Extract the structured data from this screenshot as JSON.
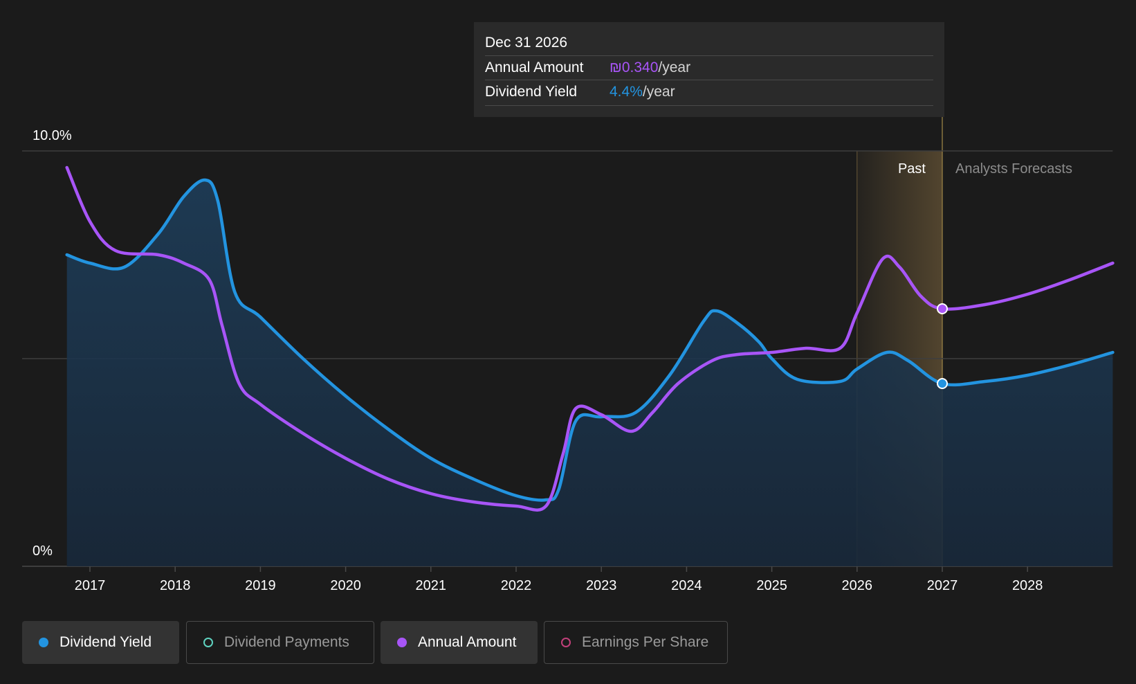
{
  "tooltip": {
    "date": "Dec 31 2026",
    "rows": [
      {
        "label": "Annual Amount",
        "value": "₪0.340",
        "unit": "/year"
      },
      {
        "label": "Dividend Yield",
        "value": "4.4%",
        "unit": "/year"
      }
    ]
  },
  "legend": [
    {
      "label": "Dividend Yield",
      "color": "#2394e0",
      "active": true
    },
    {
      "label": "Dividend Payments",
      "color": "#5fd3c0",
      "active": false
    },
    {
      "label": "Annual Amount",
      "color": "#a855f7",
      "active": true
    },
    {
      "label": "Earnings Per Share",
      "color": "#c2407a",
      "active": false
    }
  ],
  "chart_data": {
    "type": "line",
    "ylim": [
      0,
      10
    ],
    "xlim": [
      2016.5,
      2029.0
    ],
    "y_tick_labels": [
      {
        "value": 10,
        "label": "10.0%"
      },
      {
        "value": 0,
        "label": "0%"
      }
    ],
    "gridlines_y": [
      10,
      5
    ],
    "x_ticks": [
      2017,
      2018,
      2019,
      2020,
      2021,
      2022,
      2023,
      2024,
      2025,
      2026,
      2027,
      2028
    ],
    "x_tick_labels": [
      "2017",
      "2018",
      "2019",
      "2020",
      "2021",
      "2022",
      "2023",
      "2024",
      "2025",
      "2026",
      "2027",
      "2028"
    ],
    "past_label": "Past",
    "forecast_label": "Analysts Forecasts",
    "past_band": [
      2026.0,
      2027.0
    ],
    "cursor_x": 2027.0,
    "series": [
      {
        "name": "Dividend Yield",
        "color": "#2394e0",
        "fill": true,
        "points": [
          [
            2016.73,
            7.5
          ],
          [
            2017.0,
            7.3
          ],
          [
            2017.4,
            7.2
          ],
          [
            2017.8,
            8.0
          ],
          [
            2018.1,
            8.9
          ],
          [
            2018.35,
            9.3
          ],
          [
            2018.5,
            8.8
          ],
          [
            2018.7,
            6.6
          ],
          [
            2019.0,
            6.0
          ],
          [
            2019.5,
            5.0
          ],
          [
            2020.0,
            4.1
          ],
          [
            2020.5,
            3.3
          ],
          [
            2021.0,
            2.6
          ],
          [
            2021.5,
            2.1
          ],
          [
            2022.0,
            1.7
          ],
          [
            2022.35,
            1.6
          ],
          [
            2022.5,
            1.85
          ],
          [
            2022.7,
            3.5
          ],
          [
            2023.0,
            3.6
          ],
          [
            2023.4,
            3.7
          ],
          [
            2023.8,
            4.6
          ],
          [
            2024.2,
            5.9
          ],
          [
            2024.35,
            6.15
          ],
          [
            2024.6,
            5.85
          ],
          [
            2024.85,
            5.4
          ],
          [
            2025.0,
            5.0
          ],
          [
            2025.3,
            4.5
          ],
          [
            2025.8,
            4.45
          ],
          [
            2026.0,
            4.75
          ],
          [
            2026.35,
            5.15
          ],
          [
            2026.6,
            4.95
          ],
          [
            2027.0,
            4.4
          ],
          [
            2027.5,
            4.45
          ],
          [
            2028.0,
            4.6
          ],
          [
            2028.5,
            4.85
          ],
          [
            2029.0,
            5.15
          ]
        ]
      },
      {
        "name": "Annual Amount",
        "color": "#a855f7",
        "fill": false,
        "points": [
          [
            2016.73,
            9.6
          ],
          [
            2017.0,
            8.3
          ],
          [
            2017.3,
            7.6
          ],
          [
            2017.8,
            7.5
          ],
          [
            2018.1,
            7.3
          ],
          [
            2018.4,
            6.9
          ],
          [
            2018.55,
            5.8
          ],
          [
            2018.75,
            4.4
          ],
          [
            2019.0,
            3.9
          ],
          [
            2019.5,
            3.2
          ],
          [
            2020.0,
            2.6
          ],
          [
            2020.5,
            2.1
          ],
          [
            2021.0,
            1.75
          ],
          [
            2021.5,
            1.55
          ],
          [
            2022.0,
            1.45
          ],
          [
            2022.35,
            1.45
          ],
          [
            2022.55,
            2.7
          ],
          [
            2022.7,
            3.8
          ],
          [
            2023.0,
            3.65
          ],
          [
            2023.35,
            3.25
          ],
          [
            2023.6,
            3.7
          ],
          [
            2023.9,
            4.4
          ],
          [
            2024.3,
            4.95
          ],
          [
            2024.6,
            5.1
          ],
          [
            2025.0,
            5.15
          ],
          [
            2025.4,
            5.25
          ],
          [
            2025.8,
            5.25
          ],
          [
            2026.0,
            6.1
          ],
          [
            2026.3,
            7.4
          ],
          [
            2026.5,
            7.2
          ],
          [
            2026.75,
            6.5
          ],
          [
            2027.0,
            6.2
          ],
          [
            2027.5,
            6.3
          ],
          [
            2028.0,
            6.55
          ],
          [
            2028.5,
            6.9
          ],
          [
            2029.0,
            7.3
          ]
        ]
      }
    ],
    "markers": [
      {
        "series": "Annual Amount",
        "x": 2027.0,
        "y": 6.2
      },
      {
        "series": "Dividend Yield",
        "x": 2027.0,
        "y": 4.4
      }
    ]
  }
}
